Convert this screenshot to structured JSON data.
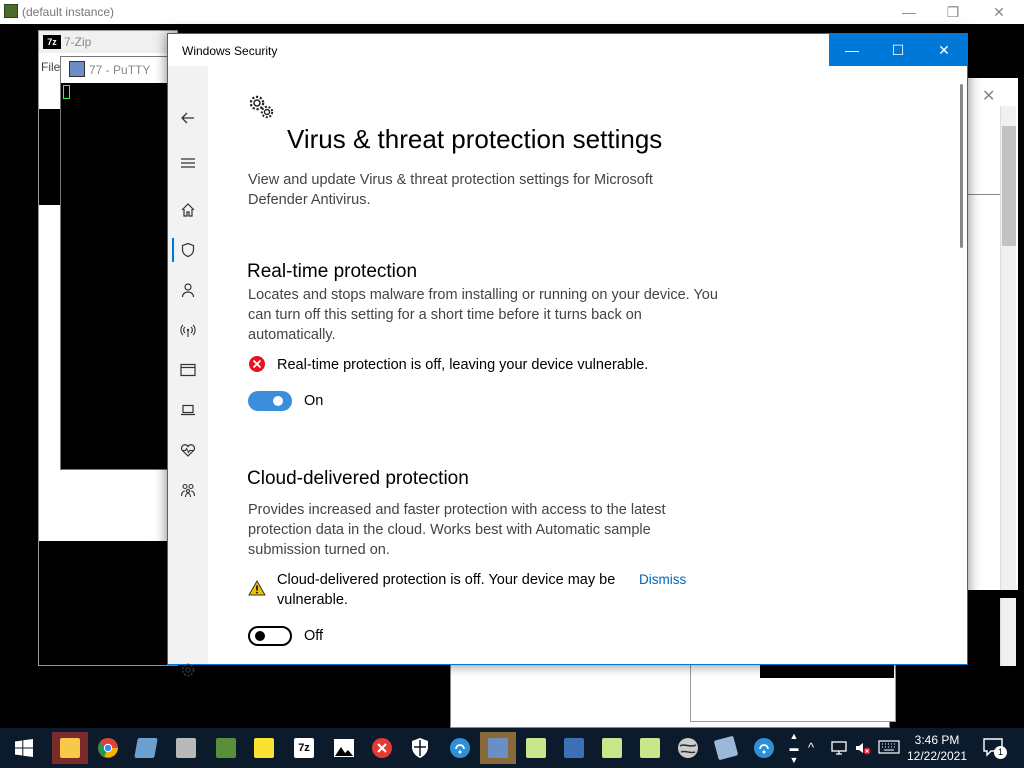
{
  "vm": {
    "title": "(default instance)",
    "controls": {
      "minimize": "—",
      "restore": "❐",
      "close": "✕"
    }
  },
  "background_windows": {
    "sevenzip": {
      "title": "7-Zip",
      "menu": "File",
      "icon_text": "7z"
    },
    "putty": {
      "title": "77 - PuTTY"
    }
  },
  "window": {
    "title": "Windows Security",
    "controls": {
      "minimize": "—",
      "maximize": "☐",
      "close": "✕"
    }
  },
  "nav": {
    "items": [
      "back",
      "menu",
      "home",
      "virus-threat-protection",
      "account-protection",
      "firewall-network",
      "app-browser-control",
      "device-security",
      "device-performance-health",
      "family-options",
      "settings"
    ],
    "active": "virus-threat-protection"
  },
  "page": {
    "title": "Virus & threat protection settings",
    "description": "View and update Virus & threat protection settings for Microsoft Defender Antivirus."
  },
  "realtime": {
    "heading": "Real-time protection",
    "description_lines": [
      "Locates and stops malware from installing or running on your device. You",
      "can turn off this setting for a short time before it turns back on",
      "automatically."
    ],
    "alert": "Real-time protection is off, leaving your device vulnerable.",
    "toggle_state": "on",
    "toggle_label": "On"
  },
  "cloud": {
    "heading": "Cloud-delivered protection",
    "description_lines": [
      "Provides increased and faster protection with access to the latest",
      "protection data in the cloud. Works best with Automatic sample",
      "submission turned on."
    ],
    "alert_lines": [
      "Cloud-delivered protection is off. Your device may be",
      "vulnerable."
    ],
    "dismiss": "Dismiss",
    "toggle_state": "off",
    "toggle_label": "Off"
  },
  "taskbar": {
    "time": "3:46 PM",
    "date": "12/22/2021",
    "notification_count": "1",
    "apps": [
      "file-explorer",
      "chrome",
      "hyper-v",
      "disk-utility",
      "minecraft",
      "sticky-notes",
      "7-zip",
      "photos",
      "close-app",
      "windows-security",
      "network-app-1",
      "putty",
      "notepad-1",
      "filezilla",
      "notepad-2",
      "notepad-3",
      "browser",
      "file-transfer",
      "network-app-2"
    ],
    "active_app": "putty"
  },
  "colors": {
    "accent": "#0078d7",
    "toggle_on": "#3b8edc",
    "error": "#e81123",
    "warning": "#f0c000",
    "link": "#0067b8",
    "taskbar": "#0b1b2c"
  }
}
